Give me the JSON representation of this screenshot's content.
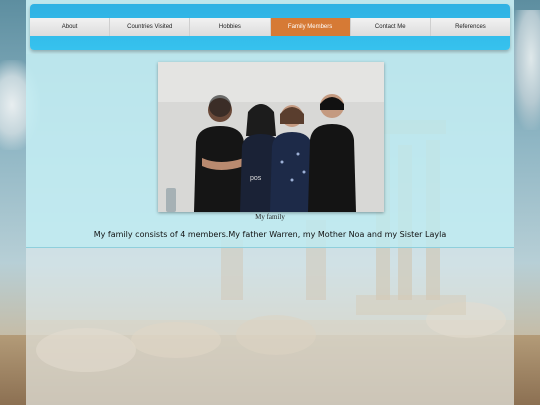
{
  "nav": {
    "items": [
      {
        "label": "About",
        "active": false
      },
      {
        "label": "Countries Visited",
        "active": false
      },
      {
        "label": "Hobbies",
        "active": false
      },
      {
        "label": "Family Members",
        "active": true
      },
      {
        "label": "Contact Me",
        "active": false
      },
      {
        "label": "References",
        "active": false
      }
    ]
  },
  "main": {
    "photo_caption": "My family",
    "description": "My family consists of 4 members.My father Warren, my Mother Noa and my Sister Layla"
  },
  "colors": {
    "nav_bar": "#36c2ee",
    "active_item": "#d67a35",
    "content_band": "#beecf2"
  }
}
